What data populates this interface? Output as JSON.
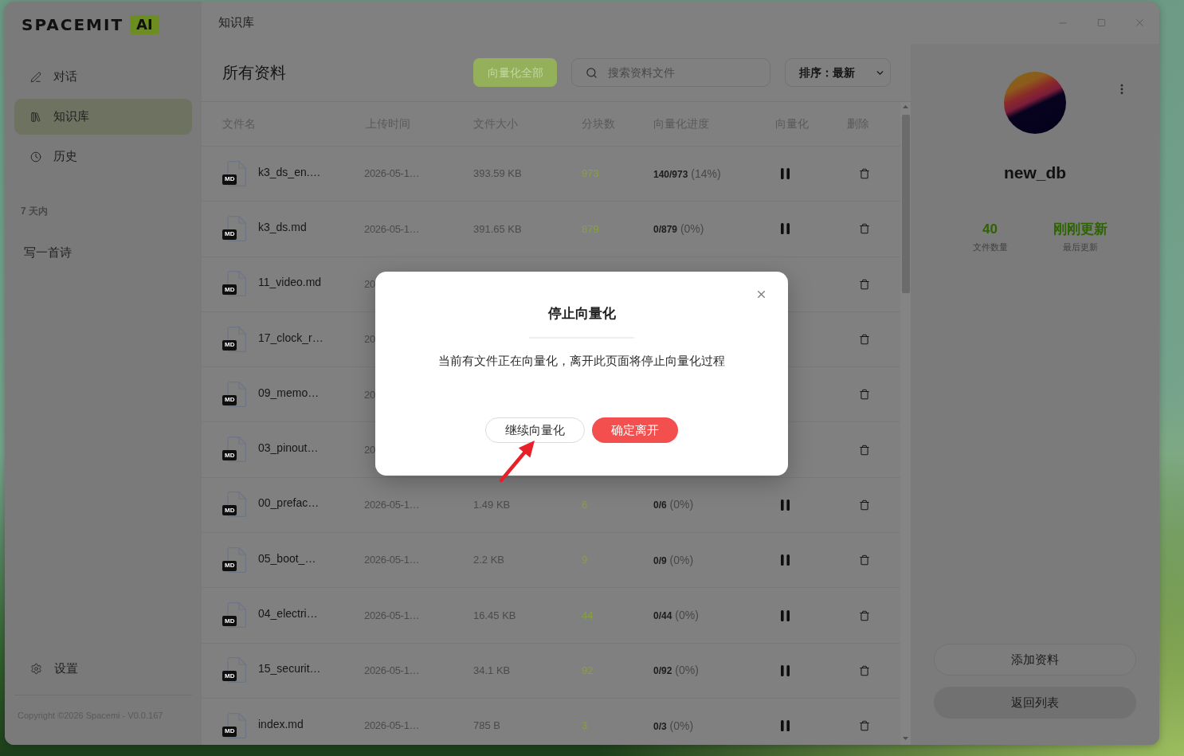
{
  "logo": {
    "wordmark": "SPACEMIT",
    "badge": "AI"
  },
  "sidebar": {
    "nav": [
      {
        "label": "对话",
        "selected": false
      },
      {
        "label": "知识库",
        "selected": true
      },
      {
        "label": "历史",
        "selected": false
      }
    ],
    "history_group": "7 天内",
    "history": [
      {
        "title": "写一首诗"
      }
    ],
    "settings": "设置",
    "copyright": "Copyright ©2026 Spacemi - V0.0.167"
  },
  "titlebar": {
    "title": "知识库"
  },
  "header": {
    "heading": "所有资料",
    "vectorize_all": "向量化全部",
    "search": {
      "placeholder": "搜索资料文件"
    },
    "sort": "排序：最新"
  },
  "table": {
    "columns": [
      "文件名",
      "上传时间",
      "文件大小",
      "分块数",
      "向量化进度",
      "向量化",
      "删除"
    ],
    "rows": [
      {
        "file_type": "MD",
        "name": "k3_ds_en.…",
        "date": "2026-05-1…",
        "size": "393.59 KB",
        "chunks": "973",
        "progress": "**140/973** (14%)",
        "vectorizing": true
      },
      {
        "file_type": "MD",
        "name": "k3_ds.md",
        "date": "2026-05-1…",
        "size": "391.65 KB",
        "chunks": "879",
        "progress": "**0/879** (0%)",
        "vectorizing": true
      },
      {
        "file_type": "MD",
        "name": "11_video.md",
        "date": "20"
      },
      {
        "file_type": "MD",
        "name": "17_clock_r…",
        "date": "20"
      },
      {
        "file_type": "MD",
        "name": "09_memo…",
        "date": "20"
      },
      {
        "file_type": "MD",
        "name": "03_pinout…",
        "date": "20"
      },
      {
        "file_type": "MD",
        "name": "00_prefac…",
        "date": "2026-05-1…",
        "size": "1.49 KB",
        "chunks": "6",
        "progress": "**0/6** (0%)",
        "vectorizing": true
      },
      {
        "file_type": "MD",
        "name": "05_boot_…",
        "date": "2026-05-1…",
        "size": "2.2 KB",
        "chunks": "9",
        "progress": "**0/9** (0%)",
        "vectorizing": true
      },
      {
        "file_type": "MD",
        "name": "04_electri…",
        "date": "2026-05-1…",
        "size": "16.45 KB",
        "chunks": "44",
        "progress": "**0/44** (0%)",
        "vectorizing": true
      },
      {
        "file_type": "MD",
        "name": "15_securit…",
        "date": "2026-05-1…",
        "size": "34.1 KB",
        "chunks": "92",
        "progress": "**0/92** (0%)",
        "vectorizing": true
      },
      {
        "file_type": "MD",
        "name": "index.md",
        "date": "2026-05-1…",
        "size": "785 B",
        "chunks": "3",
        "progress": "**0/3** (0%)",
        "vectorizing": true
      }
    ]
  },
  "panel": {
    "name": "new_db",
    "stats": [
      {
        "value": "40",
        "label": "文件数量"
      },
      {
        "value": "刚刚更新",
        "label": "最后更新"
      }
    ],
    "buttons": [
      {
        "label": "添加资料",
        "kind": "outline"
      },
      {
        "label": "返回列表",
        "kind": "filled"
      }
    ]
  },
  "dialog": {
    "title": "停止向量化",
    "message": "当前有文件正在向量化，离开此页面将停止向量化过程",
    "buttons": [
      {
        "label": "继续向量化",
        "kind": "secondary"
      },
      {
        "label": "确定离开",
        "kind": "danger"
      }
    ]
  }
}
